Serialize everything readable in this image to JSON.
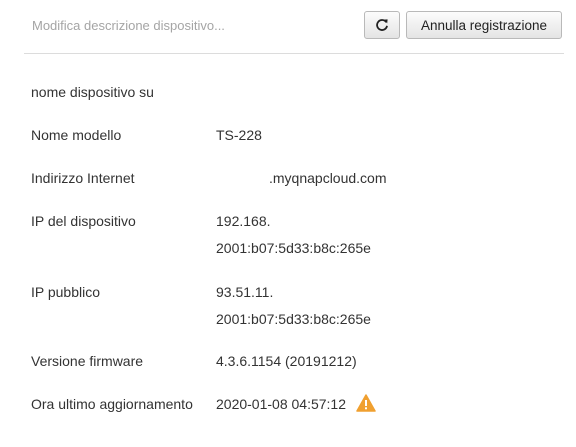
{
  "header": {
    "description_placeholder": "Modifica descrizione dispositivo...",
    "refresh_icon": "refresh-icon",
    "unregister_label": "Annulla registrazione"
  },
  "details": {
    "device_name_label": "nome dispositivo su",
    "model_label": "Nome modello",
    "model_value": "TS-228",
    "internet_address_label": "Indirizzo Internet",
    "internet_address_value": ".myqnapcloud.com",
    "device_ip_label": "IP del dispositivo",
    "device_ipv4": "192.168.",
    "device_ipv6": "2001:b07:5d33:b8c:265e",
    "public_ip_label": "IP pubblico",
    "public_ipv4": "93.51.11.",
    "public_ipv6": "2001:b07:5d33:b8c:265e",
    "firmware_label": "Versione firmware",
    "firmware_value": "4.3.6.1154 (20191212)",
    "last_update_label": "Ora ultimo aggiornamento",
    "last_update_value": "2020-01-08 04:57:12",
    "last_update_icon": "warning-icon"
  },
  "colors": {
    "warning": "#f0a030",
    "divider": "#dcdcdc"
  }
}
